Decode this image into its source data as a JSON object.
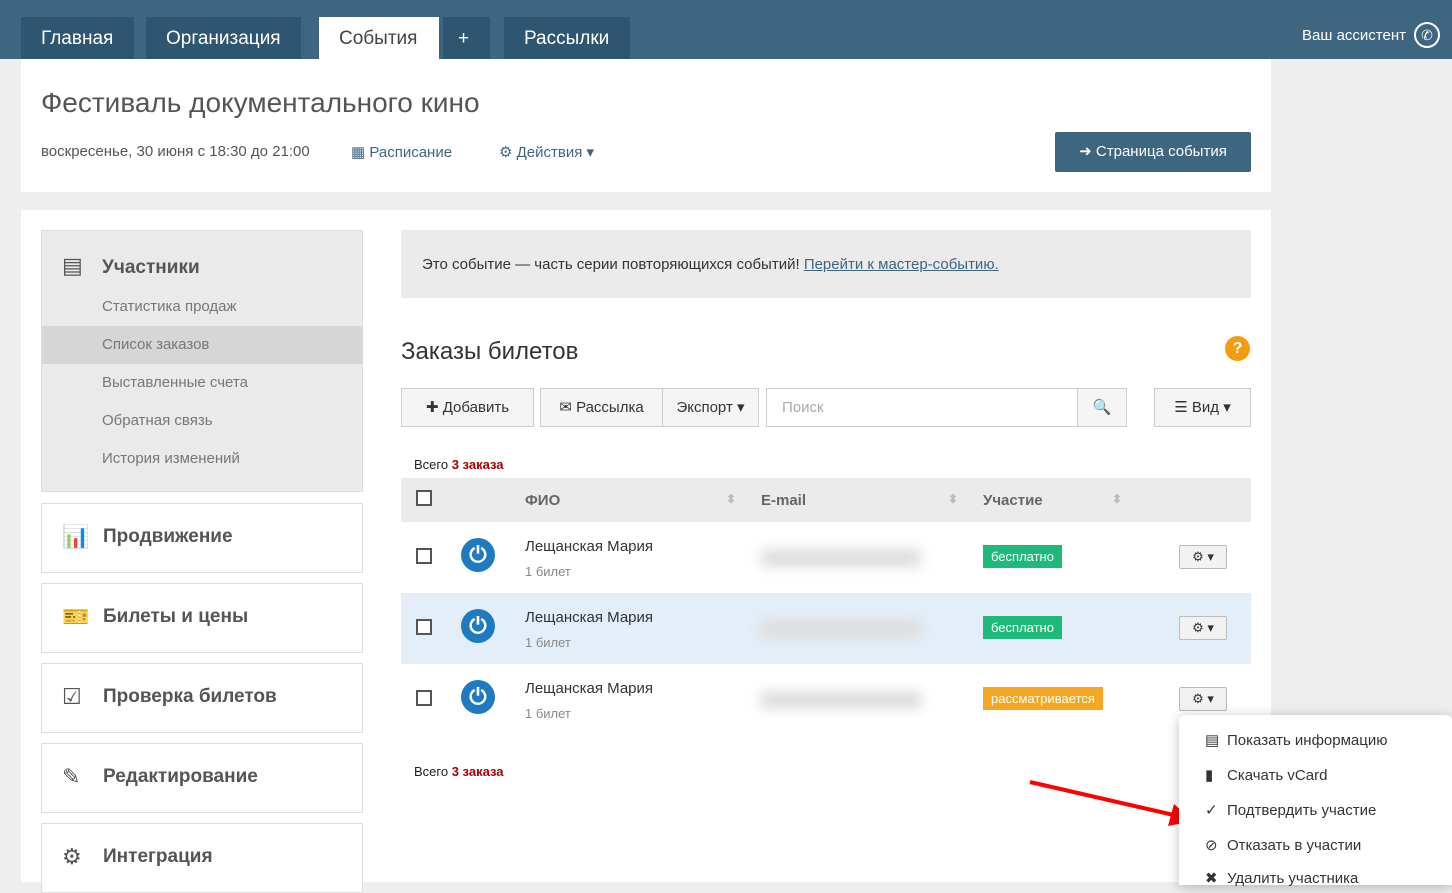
{
  "nav": {
    "tabs": [
      "Главная",
      "Организация",
      "События",
      "+",
      "Рассылки"
    ],
    "assistant": "Ваш ассистент"
  },
  "event": {
    "title": "Фестиваль документального кино",
    "date": "воскресенье, 30 июня с 18:30 до 21:00",
    "schedule": "Расписание",
    "actions": "Действия",
    "page_button": "Страница события"
  },
  "sidebar": {
    "participants": "Участники",
    "subs": [
      "Статистика продаж",
      "Список заказов",
      "Выставленные счета",
      "Обратная связь",
      "История изменений"
    ],
    "sections": [
      "Продвижение",
      "Билеты и цены",
      "Проверка билетов",
      "Редактирование",
      "Интеграция"
    ]
  },
  "notice": {
    "text": "Это событие — часть серии повторяющихся событий!",
    "link": "Перейти к мастер-событию."
  },
  "orders": {
    "title": "Заказы билетов",
    "add": "Добавить",
    "mailing": "Рассылка",
    "export": "Экспорт",
    "search_placeholder": "Поиск",
    "view": "Вид",
    "total_prefix": "Всего",
    "total_count": "3 заказа",
    "columns": [
      "ФИО",
      "E-mail",
      "Участие"
    ],
    "rows": [
      {
        "name": "Лещанская Мария",
        "tickets": "1 билет",
        "status": "бесплатно"
      },
      {
        "name": "Лещанская Мария",
        "tickets": "1 билет",
        "status": "бесплатно"
      },
      {
        "name": "Лещанская Мария",
        "tickets": "1 билет",
        "status": "рассматривается"
      }
    ]
  },
  "menu": [
    "Показать информацию",
    "Скачать vCard",
    "Подтвердить участие",
    "Отказать в участии",
    "Удалить участника"
  ],
  "colors": {
    "header": "#3e6680",
    "green": "#1fba7a",
    "orange": "#f5a623"
  }
}
